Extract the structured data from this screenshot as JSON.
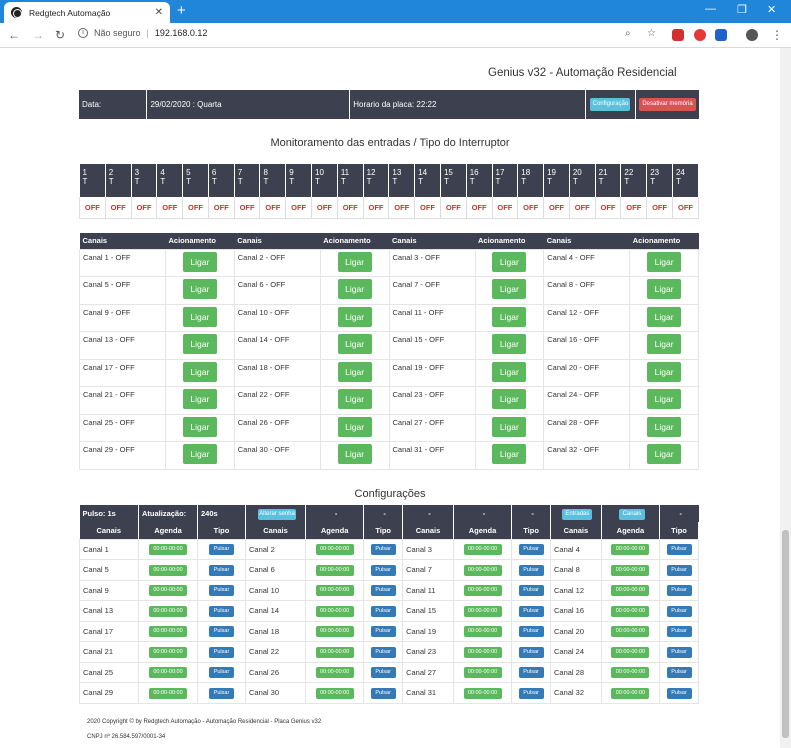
{
  "browser": {
    "tab_title": "Redgtech Automação",
    "security_label": "Não seguro",
    "url": "192.168.0.12"
  },
  "brand": "Genius v32 - Automação Residencial",
  "info": {
    "date_label": "Data:",
    "date_value": "29/02/2020 : Quarta",
    "time_label": "Horario da placa: 22:22",
    "config_button": "Configuração",
    "clear_button": "Desativar memória"
  },
  "monitor_title": "Monitoramento das entradas / Tipo do Interruptor",
  "inputs": [
    {
      "num": "1",
      "type": "T",
      "state": "OFF"
    },
    {
      "num": "2",
      "type": "T",
      "state": "OFF"
    },
    {
      "num": "3",
      "type": "T",
      "state": "OFF"
    },
    {
      "num": "4",
      "type": "T",
      "state": "OFF"
    },
    {
      "num": "5",
      "type": "T",
      "state": "OFF"
    },
    {
      "num": "6",
      "type": "T",
      "state": "OFF"
    },
    {
      "num": "7",
      "type": "T",
      "state": "OFF"
    },
    {
      "num": "8",
      "type": "T",
      "state": "OFF"
    },
    {
      "num": "9",
      "type": "T",
      "state": "OFF"
    },
    {
      "num": "10",
      "type": "T",
      "state": "OFF"
    },
    {
      "num": "11",
      "type": "T",
      "state": "OFF"
    },
    {
      "num": "12",
      "type": "T",
      "state": "OFF"
    },
    {
      "num": "13",
      "type": "T",
      "state": "OFF"
    },
    {
      "num": "14",
      "type": "T",
      "state": "OFF"
    },
    {
      "num": "15",
      "type": "T",
      "state": "OFF"
    },
    {
      "num": "16",
      "type": "T",
      "state": "OFF"
    },
    {
      "num": "17",
      "type": "T",
      "state": "OFF"
    },
    {
      "num": "18",
      "type": "T",
      "state": "OFF"
    },
    {
      "num": "19",
      "type": "T",
      "state": "OFF"
    },
    {
      "num": "20",
      "type": "T",
      "state": "OFF"
    },
    {
      "num": "21",
      "type": "T",
      "state": "OFF"
    },
    {
      "num": "22",
      "type": "T",
      "state": "OFF"
    },
    {
      "num": "23",
      "type": "T",
      "state": "OFF"
    },
    {
      "num": "24",
      "type": "T",
      "state": "OFF"
    }
  ],
  "channels_header": {
    "col_channels": "Canais",
    "col_action": "Acionamento"
  },
  "ligar_label": "Ligar",
  "channels": [
    "Canal 1 - OFF",
    "Canal 2 - OFF",
    "Canal 3 - OFF",
    "Canal 4 - OFF",
    "Canal 5 - OFF",
    "Canal 6 - OFF",
    "Canal 7 - OFF",
    "Canal 8 - OFF",
    "Canal 9 - OFF",
    "Canal 10 - OFF",
    "Canal 11 - OFF",
    "Canal 12 - OFF",
    "Canal 13 - OFF",
    "Canal 14 - OFF",
    "Canal 15 - OFF",
    "Canal 16 - OFF",
    "Canal 17 - OFF",
    "Canal 18 - OFF",
    "Canal 19 - OFF",
    "Canal 20 - OFF",
    "Canal 21 - OFF",
    "Canal 22 - OFF",
    "Canal 23 - OFF",
    "Canal 24 - OFF",
    "Canal 25 - OFF",
    "Canal 26 - OFF",
    "Canal 27 - OFF",
    "Canal 28 - OFF",
    "Canal 29 - OFF",
    "Canal 30 - OFF",
    "Canal 31 - OFF",
    "Canal 32 - OFF"
  ],
  "config_title": "Configurações",
  "config_top": {
    "pulse": "Pulso: 1s",
    "update_label": "Atualização:",
    "update_value": "240s",
    "password_button": "Alterar senha",
    "dash": "-",
    "inputs_button": "Entradas",
    "channels_button": "Canais"
  },
  "config_header": {
    "col_channels": "Canais",
    "col_schedule": "Agenda",
    "col_type": "Tipo"
  },
  "schedule_value": "00:00-00:00",
  "pulse_button": "Pulsar",
  "config_channels": [
    "Canal 1",
    "Canal 2",
    "Canal 3",
    "Canal 4",
    "Canal 5",
    "Canal 6",
    "Canal 7",
    "Canal 8",
    "Canal 9",
    "Canal 10",
    "Canal 11",
    "Canal 12",
    "Canal 13",
    "Canal 14",
    "Canal 15",
    "Canal 16",
    "Canal 17",
    "Canal 18",
    "Canal 19",
    "Canal 20",
    "Canal 21",
    "Canal 22",
    "Canal 23",
    "Canal 24",
    "Canal 25",
    "Canal 26",
    "Canal 27",
    "Canal 28",
    "Canal 29",
    "Canal 30",
    "Canal 31",
    "Canal 32"
  ],
  "footer": {
    "copyright": "2020 Copyright © by Redgtech Automação - Automação Residencial - Placa Genius v32",
    "cnpj": "CNPJ nº 26.584.597/0001-34"
  }
}
